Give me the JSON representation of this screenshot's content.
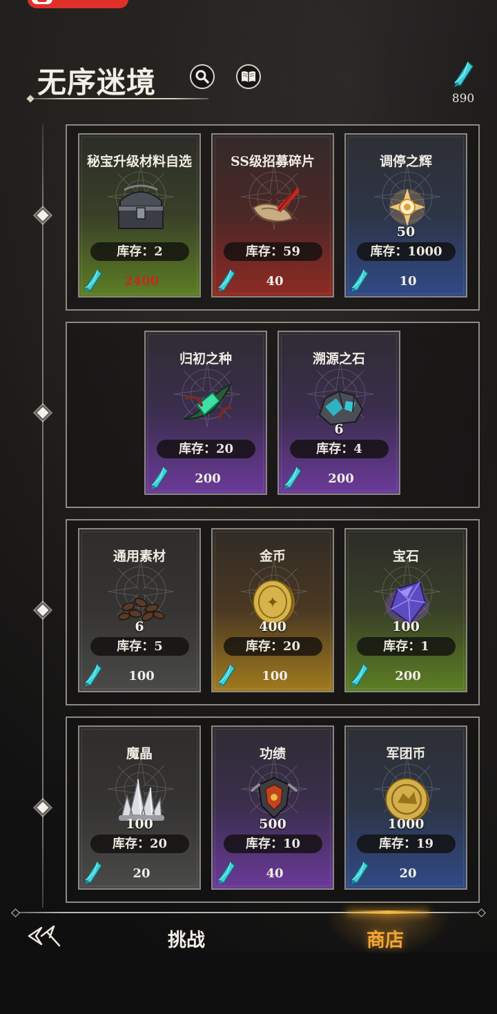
{
  "header": {
    "title": "无序迷境",
    "currency_value": "890"
  },
  "groups": [
    {
      "items": [
        {
          "name": "秘宝升级材料自选",
          "quantity": "",
          "stock": "库存：2",
          "price": "2400",
          "affordable": false,
          "rarity": "green",
          "icon": "treasure-chest-icon"
        },
        {
          "name": "SS级招募碎片",
          "quantity": "",
          "stock": "库存：59",
          "price": "40",
          "affordable": true,
          "rarity": "red",
          "icon": "scroll-quill-icon"
        },
        {
          "name": "调停之辉",
          "quantity": "50",
          "stock": "库存：1000",
          "price": "10",
          "affordable": true,
          "rarity": "blue",
          "icon": "radiant-emblem-icon"
        }
      ]
    },
    {
      "items": [
        {
          "name": "归初之种",
          "quantity": "",
          "stock": "库存：20",
          "price": "200",
          "affordable": true,
          "rarity": "purple",
          "icon": "crystal-seed-icon"
        },
        {
          "name": "溯源之石",
          "quantity": "6",
          "stock": "库存：4",
          "price": "200",
          "affordable": true,
          "rarity": "purple",
          "icon": "ore-stone-icon"
        }
      ]
    },
    {
      "items": [
        {
          "name": "通用素材",
          "quantity": "6",
          "stock": "库存：5",
          "price": "100",
          "affordable": true,
          "rarity": "gray",
          "icon": "seeds-pile-icon"
        },
        {
          "name": "金币",
          "quantity": "400",
          "stock": "库存：20",
          "price": "100",
          "affordable": true,
          "rarity": "gold",
          "icon": "gold-coin-icon"
        },
        {
          "name": "宝石",
          "quantity": "100",
          "stock": "库存：1",
          "price": "200",
          "affordable": true,
          "rarity": "green",
          "icon": "gem-icon"
        }
      ]
    },
    {
      "items": [
        {
          "name": "魔晶",
          "quantity": "100",
          "stock": "库存：20",
          "price": "20",
          "affordable": true,
          "rarity": "gray",
          "icon": "crystal-cluster-icon"
        },
        {
          "name": "功绩",
          "quantity": "500",
          "stock": "库存：10",
          "price": "40",
          "affordable": true,
          "rarity": "purple",
          "icon": "armor-medal-icon"
        },
        {
          "name": "军团币",
          "quantity": "1000",
          "stock": "库存：19",
          "price": "20",
          "affordable": true,
          "rarity": "blue",
          "icon": "legion-coin-icon"
        }
      ]
    }
  ],
  "nav": {
    "tab_challenge": "挑战",
    "tab_shop": "商店",
    "active_tab": "shop"
  },
  "colors": {
    "active_tab": "#f2a633",
    "insufficient_price": "#c42a24",
    "currency": "#3fd0d8"
  }
}
